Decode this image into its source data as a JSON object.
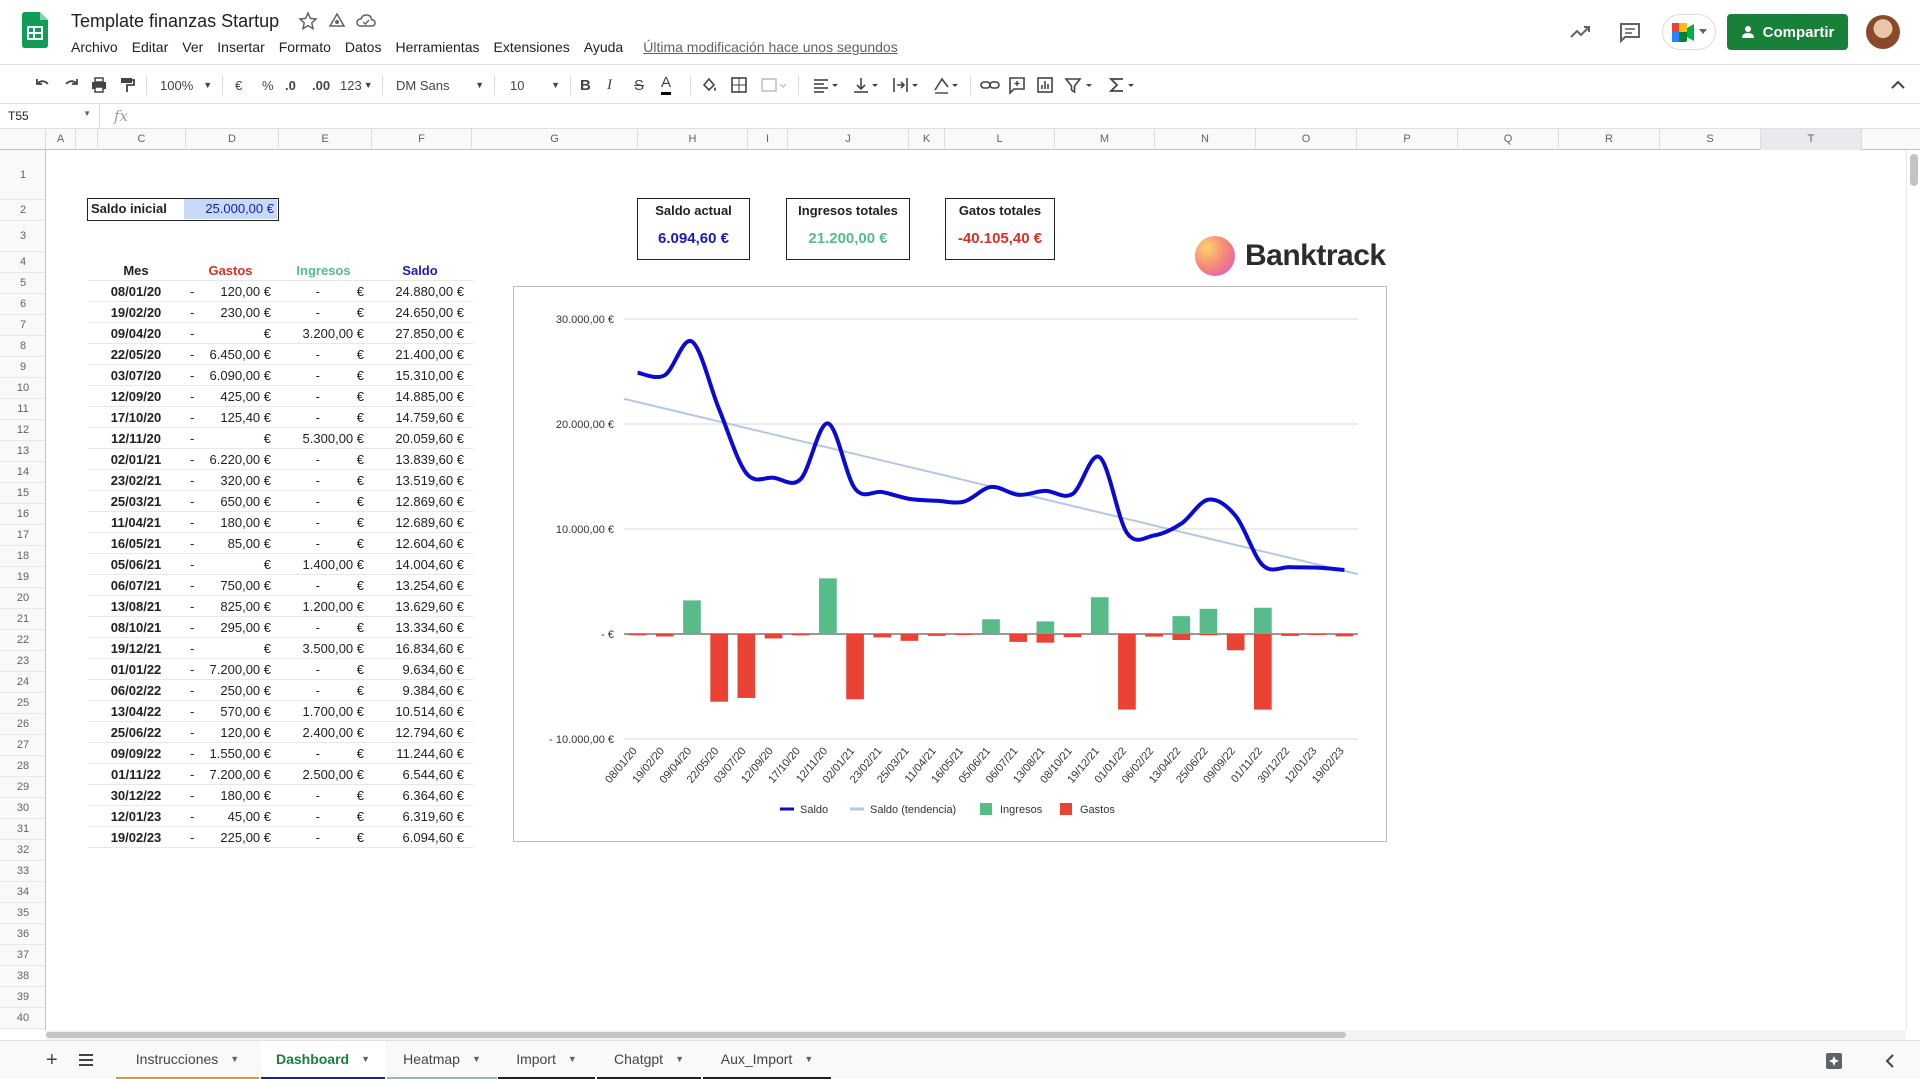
{
  "app": {
    "doc_title": "Template finanzas Startup",
    "menu": [
      "Archivo",
      "Editar",
      "Ver",
      "Insertar",
      "Formato",
      "Datos",
      "Herramientas",
      "Extensiones",
      "Ayuda"
    ],
    "last_edit": "Última modificación hace unos segundos",
    "share_label": "Compartir"
  },
  "toolbar": {
    "zoom": "100%",
    "currency": "€",
    "percent": "%",
    "dec_less": ".0",
    "dec_more": ".00",
    "format_more": "123",
    "font": "DM Sans",
    "font_size": "10"
  },
  "formula_bar": {
    "cell_ref": "T55",
    "fx": "fx",
    "content": ""
  },
  "columns": [
    "A",
    "",
    "C",
    "D",
    "E",
    "F",
    "G",
    "H",
    "I",
    "J",
    "K",
    "L",
    "M",
    "N",
    "O",
    "P",
    "Q",
    "R",
    "S",
    "T"
  ],
  "rows": [
    "1",
    "2",
    "3",
    "4",
    "5",
    "6",
    "7",
    "8",
    "9",
    "10",
    "11",
    "12",
    "13",
    "14",
    "15",
    "16",
    "17",
    "18",
    "19",
    "20",
    "21",
    "22",
    "23",
    "24",
    "25",
    "26",
    "27",
    "28",
    "29",
    "30",
    "31",
    "32",
    "33",
    "34",
    "35",
    "36",
    "37",
    "38",
    "39",
    "40"
  ],
  "saldo_inicial": {
    "label": "Saldo inicial",
    "value": "25.000,00 €"
  },
  "table": {
    "headers": [
      "Mes",
      "Gastos",
      "Ingresos",
      "Saldo"
    ],
    "header_colors": [
      "#202124",
      "#d93025",
      "#57bb8a",
      "#1a1ab8"
    ],
    "rows": [
      {
        "mes": "08/01/20",
        "gastos": "-",
        "gastos_v": "120,00 €",
        "ingresos": "-",
        "ingresos_v": "€",
        "saldo": "24.880,00 €"
      },
      {
        "mes": "19/02/20",
        "gastos": "-",
        "gastos_v": "230,00 €",
        "ingresos": "-",
        "ingresos_v": "€",
        "saldo": "24.650,00 €"
      },
      {
        "mes": "09/04/20",
        "gastos": "-",
        "gastos_v": "€",
        "ingresos": "",
        "ingresos_v": "3.200,00 €",
        "saldo": "27.850,00 €"
      },
      {
        "mes": "22/05/20",
        "gastos": "-",
        "gastos_v": "6.450,00 €",
        "ingresos": "-",
        "ingresos_v": "€",
        "saldo": "21.400,00 €"
      },
      {
        "mes": "03/07/20",
        "gastos": "-",
        "gastos_v": "6.090,00 €",
        "ingresos": "-",
        "ingresos_v": "€",
        "saldo": "15.310,00 €"
      },
      {
        "mes": "12/09/20",
        "gastos": "-",
        "gastos_v": "425,00 €",
        "ingresos": "-",
        "ingresos_v": "€",
        "saldo": "14.885,00 €"
      },
      {
        "mes": "17/10/20",
        "gastos": "-",
        "gastos_v": "125,40 €",
        "ingresos": "-",
        "ingresos_v": "€",
        "saldo": "14.759,60 €"
      },
      {
        "mes": "12/11/20",
        "gastos": "-",
        "gastos_v": "€",
        "ingresos": "",
        "ingresos_v": "5.300,00 €",
        "saldo": "20.059,60 €"
      },
      {
        "mes": "02/01/21",
        "gastos": "-",
        "gastos_v": "6.220,00 €",
        "ingresos": "-",
        "ingresos_v": "€",
        "saldo": "13.839,60 €"
      },
      {
        "mes": "23/02/21",
        "gastos": "-",
        "gastos_v": "320,00 €",
        "ingresos": "-",
        "ingresos_v": "€",
        "saldo": "13.519,60 €"
      },
      {
        "mes": "25/03/21",
        "gastos": "-",
        "gastos_v": "650,00 €",
        "ingresos": "-",
        "ingresos_v": "€",
        "saldo": "12.869,60 €"
      },
      {
        "mes": "11/04/21",
        "gastos": "-",
        "gastos_v": "180,00 €",
        "ingresos": "-",
        "ingresos_v": "€",
        "saldo": "12.689,60 €"
      },
      {
        "mes": "16/05/21",
        "gastos": "-",
        "gastos_v": "85,00 €",
        "ingresos": "-",
        "ingresos_v": "€",
        "saldo": "12.604,60 €"
      },
      {
        "mes": "05/06/21",
        "gastos": "-",
        "gastos_v": "€",
        "ingresos": "",
        "ingresos_v": "1.400,00 €",
        "saldo": "14.004,60 €"
      },
      {
        "mes": "06/07/21",
        "gastos": "-",
        "gastos_v": "750,00 €",
        "ingresos": "-",
        "ingresos_v": "€",
        "saldo": "13.254,60 €"
      },
      {
        "mes": "13/08/21",
        "gastos": "-",
        "gastos_v": "825,00 €",
        "ingresos": "",
        "ingresos_v": "1.200,00 €",
        "saldo": "13.629,60 €"
      },
      {
        "mes": "08/10/21",
        "gastos": "-",
        "gastos_v": "295,00 €",
        "ingresos": "-",
        "ingresos_v": "€",
        "saldo": "13.334,60 €"
      },
      {
        "mes": "19/12/21",
        "gastos": "-",
        "gastos_v": "€",
        "ingresos": "",
        "ingresos_v": "3.500,00 €",
        "saldo": "16.834,60 €"
      },
      {
        "mes": "01/01/22",
        "gastos": "-",
        "gastos_v": "7.200,00 €",
        "ingresos": "-",
        "ingresos_v": "€",
        "saldo": "9.634,60 €"
      },
      {
        "mes": "06/02/22",
        "gastos": "-",
        "gastos_v": "250,00 €",
        "ingresos": "-",
        "ingresos_v": "€",
        "saldo": "9.384,60 €"
      },
      {
        "mes": "13/04/22",
        "gastos": "-",
        "gastos_v": "570,00 €",
        "ingresos": "",
        "ingresos_v": "1.700,00 €",
        "saldo": "10.514,60 €"
      },
      {
        "mes": "25/06/22",
        "gastos": "-",
        "gastos_v": "120,00 €",
        "ingresos": "",
        "ingresos_v": "2.400,00 €",
        "saldo": "12.794,60 €"
      },
      {
        "mes": "09/09/22",
        "gastos": "-",
        "gastos_v": "1.550,00 €",
        "ingresos": "-",
        "ingresos_v": "€",
        "saldo": "11.244,60 €"
      },
      {
        "mes": "01/11/22",
        "gastos": "-",
        "gastos_v": "7.200,00 €",
        "ingresos": "",
        "ingresos_v": "2.500,00 €",
        "saldo": "6.544,60 €"
      },
      {
        "mes": "30/12/22",
        "gastos": "-",
        "gastos_v": "180,00 €",
        "ingresos": "-",
        "ingresos_v": "€",
        "saldo": "6.364,60 €"
      },
      {
        "mes": "12/01/23",
        "gastos": "-",
        "gastos_v": "45,00 €",
        "ingresos": "-",
        "ingresos_v": "€",
        "saldo": "6.319,60 €"
      },
      {
        "mes": "19/02/23",
        "gastos": "-",
        "gastos_v": "225,00 €",
        "ingresos": "-",
        "ingresos_v": "€",
        "saldo": "6.094,60 €"
      }
    ]
  },
  "kpis": [
    {
      "label": "Saldo actual",
      "value": "6.094,60 €",
      "color": "#1a1ab8"
    },
    {
      "label": "Ingresos totales",
      "value": "21.200,00 €",
      "color": "#57bb8a"
    },
    {
      "label": "Gatos totales",
      "value": "-40.105,40 €",
      "color": "#d93025"
    }
  ],
  "brand": "Banktrack",
  "chart_data": {
    "type": "bar",
    "categories": [
      "08/01/20",
      "19/02/20",
      "09/04/20",
      "22/05/20",
      "03/07/20",
      "12/09/20",
      "17/10/20",
      "12/11/20",
      "02/01/21",
      "23/02/21",
      "25/03/21",
      "11/04/21",
      "16/05/21",
      "05/06/21",
      "06/07/21",
      "13/08/21",
      "08/10/21",
      "19/12/21",
      "01/01/22",
      "06/02/22",
      "13/04/22",
      "25/06/22",
      "09/09/22",
      "01/11/22",
      "30/12/22",
      "12/01/23",
      "19/02/23"
    ],
    "series": [
      {
        "name": "Saldo",
        "kind": "line",
        "color": "#0b0bcf",
        "values": [
          24880,
          24650,
          27850,
          21400,
          15310,
          14885,
          14759.6,
          20059.6,
          13839.6,
          13519.6,
          12869.6,
          12689.6,
          12604.6,
          14004.6,
          13254.6,
          13629.6,
          13334.6,
          16834.6,
          9634.6,
          9384.6,
          10514.6,
          12794.6,
          11244.6,
          6544.6,
          6364.6,
          6319.6,
          6094.6
        ]
      },
      {
        "name": "Saldo (tendencia)",
        "kind": "trend",
        "color": "#b4c7e7",
        "values": [
          22400,
          5700
        ]
      },
      {
        "name": "Ingresos",
        "kind": "bar",
        "color": "#57bb8a",
        "values": [
          0,
          0,
          3200,
          0,
          0,
          0,
          0,
          5300,
          0,
          0,
          0,
          0,
          0,
          1400,
          0,
          1200,
          0,
          3500,
          0,
          0,
          1700,
          2400,
          0,
          2500,
          0,
          0,
          0
        ]
      },
      {
        "name": "Gastos",
        "kind": "bar",
        "color": "#ea4335",
        "values": [
          -120,
          -230,
          0,
          -6450,
          -6090,
          -425,
          -125.4,
          0,
          -6220,
          -320,
          -650,
          -180,
          -85,
          0,
          -750,
          -825,
          -295,
          0,
          -7200,
          -250,
          -570,
          -120,
          -1550,
          -7200,
          -180,
          -45,
          -225
        ]
      }
    ],
    "y_ticks": [
      "30.000,00 €",
      "20.000,00 €",
      "10.000,00 €",
      "-  €",
      "- 10.000,00 €"
    ],
    "y_tick_values": [
      30000,
      20000,
      10000,
      0,
      -10000
    ],
    "ylim": [
      -10000,
      30000
    ],
    "grid": true,
    "legend_position": "bottom"
  },
  "sheet_tabs": [
    {
      "label": "Instrucciones",
      "color": "#f29900",
      "active": false
    },
    {
      "label": "Dashboard",
      "color": "#1a1ab8",
      "active": true
    },
    {
      "label": "Heatmap",
      "color": "#81c995",
      "active": false
    },
    {
      "label": "Import",
      "color": "#202124",
      "active": false
    },
    {
      "label": "Chatgpt",
      "color": "#202124",
      "active": false
    },
    {
      "label": "Aux_Import",
      "color": "#202124",
      "active": false
    }
  ]
}
